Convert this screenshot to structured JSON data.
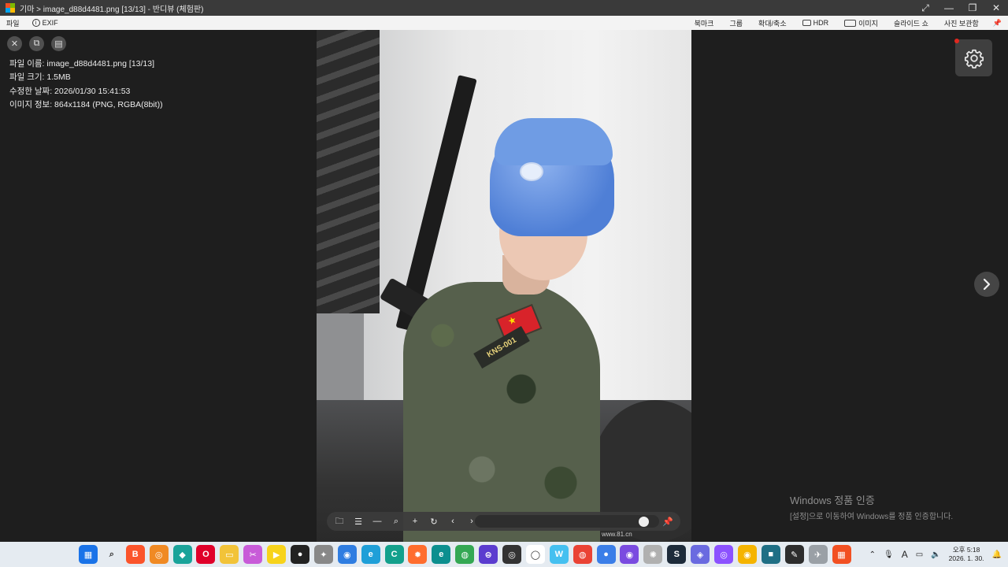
{
  "titlebar": {
    "title": "기마 > image_d88d4481.png [13/13] - 반디뷰 (체험판)",
    "controls": [
      "restore-size",
      "minimize",
      "maximize",
      "close"
    ]
  },
  "menubar": {
    "left": [
      {
        "label": "파일"
      },
      {
        "label": "EXIF",
        "icon": "info-icon"
      }
    ],
    "right": [
      {
        "label": "북마크"
      },
      {
        "label": "그룹"
      },
      {
        "label": "확대/축소"
      },
      {
        "label": "HDR",
        "icon": "hdr-icon"
      },
      {
        "label": "이미지",
        "icon": "image-icon"
      },
      {
        "label": "슬라이드 쇼"
      },
      {
        "label": "사진 보관함"
      }
    ]
  },
  "info_panel": {
    "file_name": "파일 이름: image_d88d4481.png [13/13]",
    "file_size": "파일 크기: 1.5MB",
    "modified": "수정한 날짜: 2026/01/30 15:41:53",
    "image_info": "이미지 정보: 864x1184 (PNG, RGBA(8bit))"
  },
  "photo": {
    "patch_text": "KNS-001",
    "watermark": "www.81.cn"
  },
  "viewer_toolbar": {
    "slider_value": 0.95
  },
  "activation": {
    "title": "Windows 정품 인증",
    "subtitle": "[설정]으로 이동하여 Windows를 정품 인증합니다."
  },
  "taskbar": {
    "icons": [
      {
        "name": "start-icon",
        "color": "#1a73e8",
        "glyph": "▦"
      },
      {
        "name": "search-icon",
        "color": "#e5ebf1",
        "glyph": "⌕"
      },
      {
        "name": "brave-icon",
        "color": "#fb542b",
        "glyph": "B"
      },
      {
        "name": "app-orange-icon",
        "color": "#f08a24",
        "glyph": "◎"
      },
      {
        "name": "app-teal-icon",
        "color": "#1aa39a",
        "glyph": "◆"
      },
      {
        "name": "opera-icon",
        "color": "#e0002a",
        "glyph": "O"
      },
      {
        "name": "file-explorer-icon",
        "color": "#f2c339",
        "glyph": "▭"
      },
      {
        "name": "snipping-icon",
        "color": "#c85bd8",
        "glyph": "✂"
      },
      {
        "name": "app-yellow-icon",
        "color": "#f7d31b",
        "glyph": "▶"
      },
      {
        "name": "app-black-icon",
        "color": "#222222",
        "glyph": "●"
      },
      {
        "name": "app-gray-icon",
        "color": "#888888",
        "glyph": "✦"
      },
      {
        "name": "app-blue-circle-icon",
        "color": "#2f7de1",
        "glyph": "◉"
      },
      {
        "name": "edge-icon",
        "color": "#1f9fd8",
        "glyph": "e"
      },
      {
        "name": "app-green-icon",
        "color": "#13a08c",
        "glyph": "C"
      },
      {
        "name": "firefox-icon",
        "color": "#ff6d2e",
        "glyph": "✹"
      },
      {
        "name": "edge-alt-icon",
        "color": "#0c8f8f",
        "glyph": "e"
      },
      {
        "name": "chrome-icon",
        "color": "#34a853",
        "glyph": "◍"
      },
      {
        "name": "app-purple-icon",
        "color": "#5b3ccf",
        "glyph": "⊜"
      },
      {
        "name": "app-dark-icon",
        "color": "#333333",
        "glyph": "◎"
      },
      {
        "name": "app-orange-ring-icon",
        "color": "#ffffff",
        "glyph": "◯"
      },
      {
        "name": "app-w-icon",
        "color": "#45c0f0",
        "glyph": "W"
      },
      {
        "name": "chrome-alt-icon",
        "color": "#ea4335",
        "glyph": "◍"
      },
      {
        "name": "app-blue-icon",
        "color": "#3b7ee8",
        "glyph": "●"
      },
      {
        "name": "app-violet-icon",
        "color": "#7a4be0",
        "glyph": "◉"
      },
      {
        "name": "app-swirl-icon",
        "color": "#b0b0b0",
        "glyph": "✺"
      },
      {
        "name": "app-dark-s-icon",
        "color": "#1d2b3a",
        "glyph": "S"
      },
      {
        "name": "app-indigo-icon",
        "color": "#6a6ae0",
        "glyph": "◈"
      },
      {
        "name": "app-purple-ring-icon",
        "color": "#8c52ff",
        "glyph": "◎"
      },
      {
        "name": "app-yellow-ring-icon",
        "color": "#f5b400",
        "glyph": "◉"
      },
      {
        "name": "app-teal-square-icon",
        "color": "#1f6f85",
        "glyph": "■"
      },
      {
        "name": "app-note-icon",
        "color": "#2d2d2d",
        "glyph": "✎"
      },
      {
        "name": "app-gray-tool-icon",
        "color": "#9aa0a6",
        "glyph": "✈"
      },
      {
        "name": "app-colorful-icon",
        "color": "#f25022",
        "glyph": "▦"
      }
    ],
    "tray": {
      "clock_time": "오후 5:18",
      "clock_date": "2026. 1. 30."
    }
  }
}
